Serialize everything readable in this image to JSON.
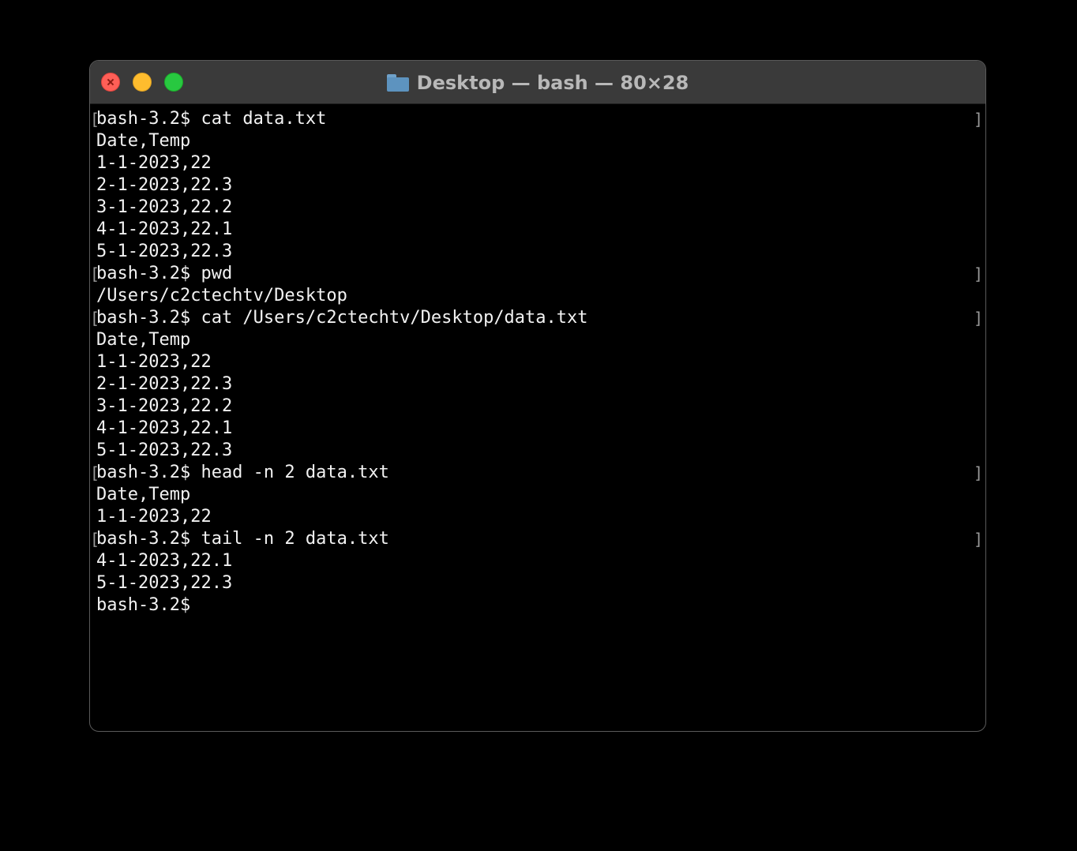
{
  "window": {
    "title": "Desktop — bash — 80×28",
    "title_icon": "folder-icon"
  },
  "terminal": {
    "lines": [
      {
        "text": "bash-3.2$ cat data.txt",
        "prompt": true
      },
      {
        "text": "Date,Temp",
        "prompt": false
      },
      {
        "text": "1-1-2023,22",
        "prompt": false
      },
      {
        "text": "2-1-2023,22.3",
        "prompt": false
      },
      {
        "text": "3-1-2023,22.2",
        "prompt": false
      },
      {
        "text": "4-1-2023,22.1",
        "prompt": false
      },
      {
        "text": "5-1-2023,22.3",
        "prompt": false
      },
      {
        "text": "bash-3.2$ pwd",
        "prompt": true
      },
      {
        "text": "/Users/c2ctechtv/Desktop",
        "prompt": false
      },
      {
        "text": "bash-3.2$ cat /Users/c2ctechtv/Desktop/data.txt",
        "prompt": true
      },
      {
        "text": "Date,Temp",
        "prompt": false
      },
      {
        "text": "1-1-2023,22",
        "prompt": false
      },
      {
        "text": "2-1-2023,22.3",
        "prompt": false
      },
      {
        "text": "3-1-2023,22.2",
        "prompt": false
      },
      {
        "text": "4-1-2023,22.1",
        "prompt": false
      },
      {
        "text": "5-1-2023,22.3",
        "prompt": false
      },
      {
        "text": "bash-3.2$ head -n 2 data.txt",
        "prompt": true
      },
      {
        "text": "Date,Temp",
        "prompt": false
      },
      {
        "text": "1-1-2023,22",
        "prompt": false
      },
      {
        "text": "bash-3.2$ tail -n 2 data.txt",
        "prompt": true
      },
      {
        "text": "4-1-2023,22.1",
        "prompt": false
      },
      {
        "text": "5-1-2023,22.3",
        "prompt": false
      },
      {
        "text": "bash-3.2$",
        "prompt": false
      }
    ]
  },
  "colors": {
    "close": "#fe5f57",
    "minimize": "#febc2e",
    "zoom": "#28c840",
    "titlebar": "#3a3a3a",
    "terminal_bg": "#000000",
    "terminal_fg": "#f2f2f2"
  }
}
